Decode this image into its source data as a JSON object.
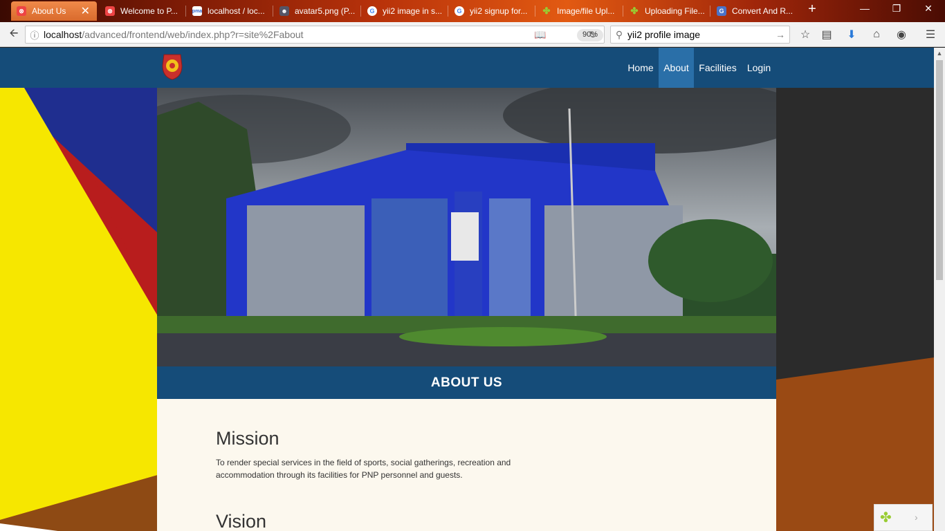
{
  "browser": {
    "tabs": [
      {
        "title": "About Us",
        "favicon": "php-icon",
        "active": true
      },
      {
        "title": "Welcome to P...",
        "favicon": "php-icon"
      },
      {
        "title": "localhost / loc...",
        "favicon": "phpmyadmin-icon"
      },
      {
        "title": "avatar5.png (P...",
        "favicon": "avatar-icon"
      },
      {
        "title": "yii2 image in s...",
        "favicon": "google-icon"
      },
      {
        "title": "yii2 signup for...",
        "favicon": "google-icon"
      },
      {
        "title": "Image/file Upl...",
        "favicon": "yii-icon"
      },
      {
        "title": "Uploading File...",
        "favicon": "yii-icon"
      },
      {
        "title": "Convert And R...",
        "favicon": "google-g-icon"
      }
    ],
    "url": {
      "host": "localhost",
      "path": "/advanced/frontend/web/index.php?r=site%2Fabout"
    },
    "zoom": "90%",
    "search_query": "yii2 profile image"
  },
  "site": {
    "menu": [
      {
        "label": "Home"
      },
      {
        "label": "About",
        "active": true
      },
      {
        "label": "Facilities"
      },
      {
        "label": "Login"
      }
    ],
    "section_title": "ABOUT US",
    "mission": {
      "heading": "Mission",
      "text": "To render special services in the field of sports, social gatherings, recreation and accommodation through its facilities for PNP personnel and guests."
    },
    "vision": {
      "heading": "Vision"
    }
  },
  "colors": {
    "nav": "#154c79",
    "nav_active": "#2a6fa8",
    "content_bg": "#fcf8ee"
  }
}
